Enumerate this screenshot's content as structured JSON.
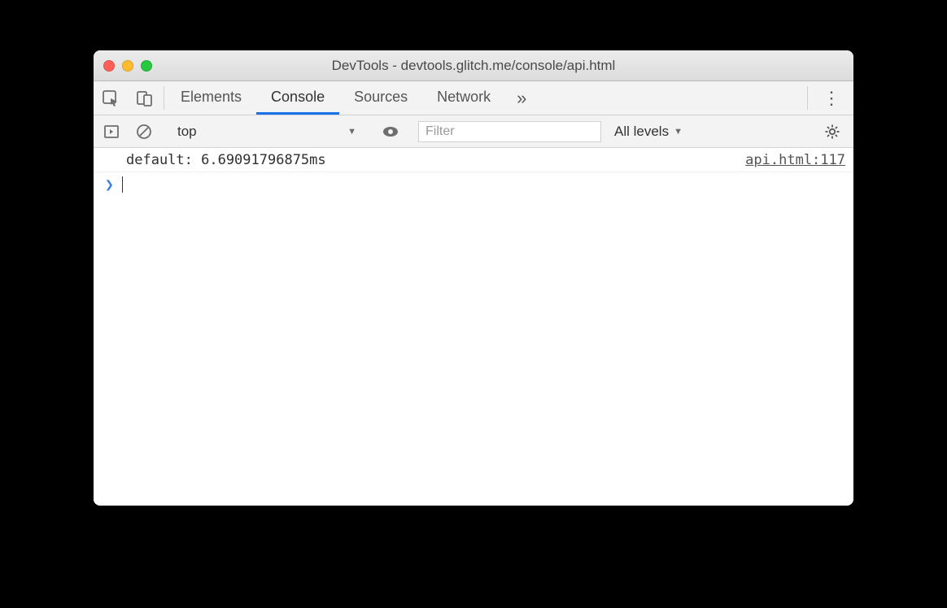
{
  "window": {
    "title": "DevTools - devtools.glitch.me/console/api.html"
  },
  "tabs": {
    "items": [
      "Elements",
      "Console",
      "Sources",
      "Network"
    ],
    "active_index": 1,
    "more_glyph": "»",
    "kebab_glyph": "⋮"
  },
  "filterbar": {
    "context": "top",
    "caret_glyph": "▼",
    "filter_placeholder": "Filter",
    "levels_label": "All levels",
    "levels_caret": "▼"
  },
  "console": {
    "rows": [
      {
        "text": "default: 6.69091796875ms",
        "source": "api.html:117"
      }
    ],
    "prompt_glyph": "❯"
  }
}
